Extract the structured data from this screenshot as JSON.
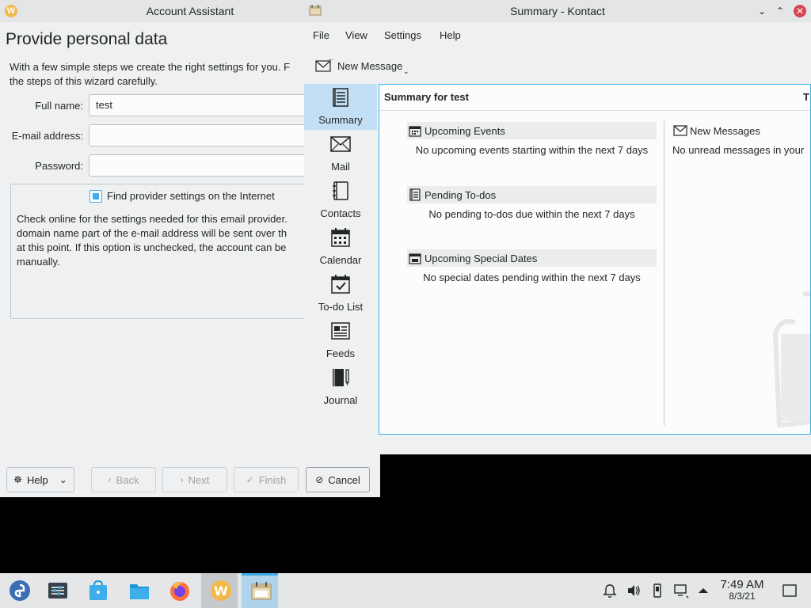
{
  "account_assistant": {
    "title": "Account Assistant",
    "heading": "Provide personal data",
    "intro_line1": "With a few simple steps we create the right settings for you. F",
    "intro_line2": "the steps of this wizard carefully.",
    "full_name_label": "Full name:",
    "full_name_value": "test",
    "email_label": "E-mail address:",
    "email_value": "",
    "password_label": "Password:",
    "password_value": "",
    "find_provider_label": "Find provider settings on the Internet",
    "find_provider_checked": true,
    "desc_line1": "Check online for the settings needed for this email provider.",
    "desc_line2": "domain name part of the e-mail address will be sent over th",
    "desc_line3": "at this point. If this option is unchecked, the account can be",
    "desc_line4": "manually.",
    "buttons": {
      "help": "Help",
      "back": "Back",
      "next": "Next",
      "finish": "Finish",
      "cancel": "Cancel"
    }
  },
  "kontact": {
    "title": "Summary - Kontact",
    "menu": [
      "File",
      "View",
      "Settings",
      "Help"
    ],
    "toolbar_new_message": "New Message",
    "sidebar": [
      {
        "label": "Summary",
        "icon": "summary-icon",
        "active": true
      },
      {
        "label": "Mail",
        "icon": "mail-icon"
      },
      {
        "label": "Contacts",
        "icon": "contacts-icon"
      },
      {
        "label": "Calendar",
        "icon": "calendar-icon"
      },
      {
        "label": "To-do List",
        "icon": "todo-icon"
      },
      {
        "label": "Feeds",
        "icon": "feeds-icon"
      },
      {
        "label": "Journal",
        "icon": "journal-icon"
      }
    ],
    "summary": {
      "title": "Summary for test",
      "title_right": "T",
      "sections_left": [
        {
          "title": "Upcoming Events",
          "body": "No upcoming events starting within the next 7 days"
        },
        {
          "title": "Pending To-dos",
          "body": "No pending to-dos due within the next 7 days"
        },
        {
          "title": "Upcoming Special Dates",
          "body": "No special dates pending within the next 7 days"
        }
      ],
      "sections_right": [
        {
          "title": "New Messages",
          "body": "No unread messages in your"
        }
      ]
    }
  },
  "taskbar": {
    "apps": [
      "fedora-launcher-icon",
      "system-settings-icon",
      "discover-icon",
      "dolphin-icon",
      "firefox-icon",
      "account-wizard-icon",
      "kontact-icon"
    ],
    "time": "7:49 AM",
    "date": "8/3/21"
  },
  "colors": {
    "accent": "#3daee9",
    "close": "#da4453",
    "window_bg": "#eff0f1",
    "view_bg": "#fcfcfc",
    "desktop": "#000000"
  }
}
